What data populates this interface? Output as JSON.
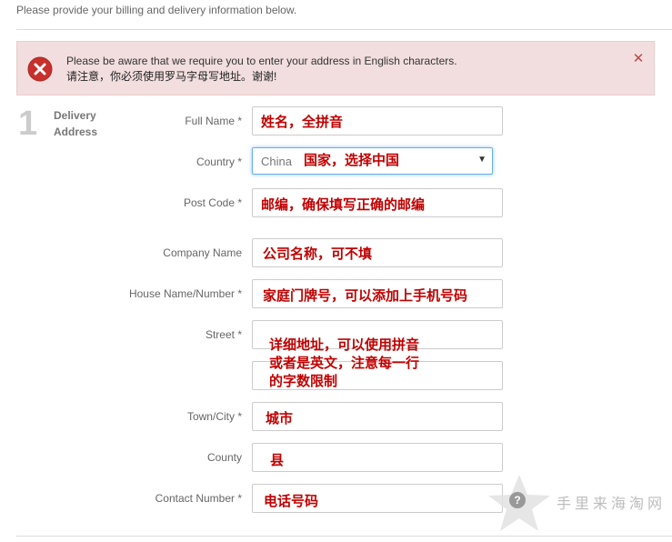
{
  "intro": "Please provide your billing and delivery information below.",
  "alert": {
    "line_en": "Please be aware that we require you to enter your address in English characters.",
    "line_zh": "请注意，你必须使用罗马字母写地址。谢谢!",
    "close": "✕"
  },
  "step": {
    "number": "1",
    "label_line1": "Delivery",
    "label_line2": "Address"
  },
  "form": {
    "full_name": {
      "label": "Full Name *",
      "note": "姓名，全拼音"
    },
    "country": {
      "label": "Country *",
      "value": "China",
      "note": "国家，选择中国",
      "arrow": "▼"
    },
    "post_code": {
      "label": "Post Code *",
      "note": "邮编，确保填写正确的邮编"
    },
    "company_name": {
      "label": "Company Name",
      "note": "公司名称，可不填"
    },
    "house_name": {
      "label": "House Name/Number *",
      "note": "家庭门牌号，可以添加上手机号码"
    },
    "street": {
      "label": "Street *",
      "note": "详细地址，可以使用拼音或者是英文，注意每一行的字数限制"
    },
    "town_city": {
      "label": "Town/City *",
      "note": "城市"
    },
    "county": {
      "label": "County",
      "note": "县"
    },
    "contact_number": {
      "label": "Contact Number *",
      "note": "电话号码"
    }
  },
  "watermark": {
    "text": "手里来海淘网",
    "badge": "?"
  },
  "colors": {
    "alert_bg": "#f2dede",
    "note_red": "#c00000",
    "error_red": "#b94a48"
  }
}
